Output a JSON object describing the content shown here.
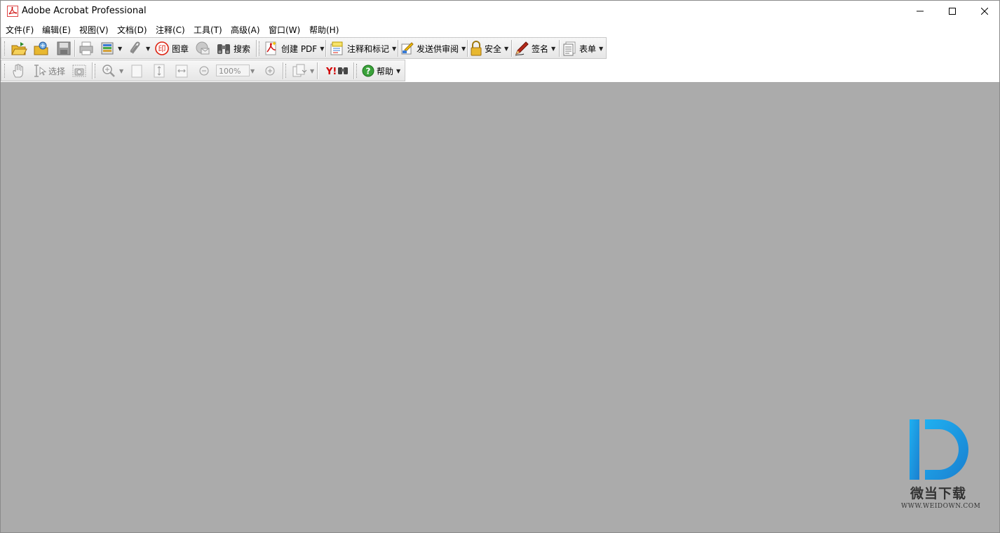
{
  "window": {
    "title": "Adobe Acrobat Professional"
  },
  "menu": [
    "文件(F)",
    "编辑(E)",
    "视图(V)",
    "文档(D)",
    "注释(C)",
    "工具(T)",
    "高级(A)",
    "窗口(W)",
    "帮助(H)"
  ],
  "toolbar1": {
    "stamp_label": "图章",
    "search_label": "搜索",
    "create_pdf_label": "创建 PDF",
    "comment_label": "注释和标记",
    "send_review_label": "发送供审阅",
    "security_label": "安全",
    "sign_label": "签名",
    "forms_label": "表单"
  },
  "toolbar2": {
    "select_label": "选择",
    "zoom_value": "100%",
    "help_label": "帮助"
  },
  "watermark": {
    "brand": "微当下载",
    "url": "WWW.WEIDOWN.COM"
  },
  "colors": {
    "workspace": "#ababab",
    "toolbar": "#e6e6e6",
    "acrobat_red": "#cc1111",
    "watermark_blue": "#1e9ae0"
  }
}
